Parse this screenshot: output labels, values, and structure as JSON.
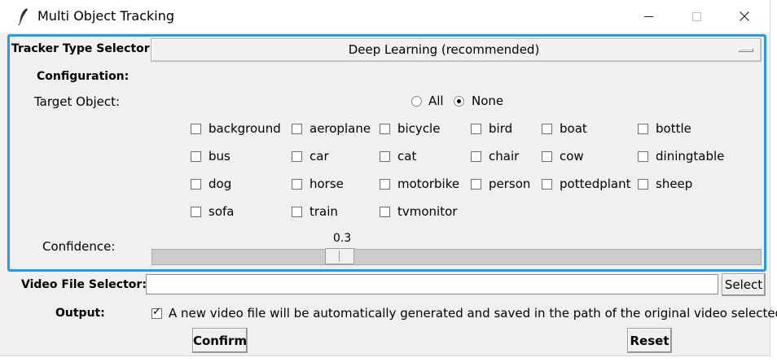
{
  "window": {
    "title": "Multi Object Tracking"
  },
  "tracker": {
    "label": "Tracker Type Selector:",
    "selected": "Deep Learning (recommended)"
  },
  "configuration": {
    "label": "Configuration:"
  },
  "target": {
    "label": "Target Object:",
    "radio_all": "All",
    "radio_none": "None",
    "selected_radio": "None",
    "objects": [
      "background",
      "aeroplane",
      "bicycle",
      "bird",
      "boat",
      "bottle",
      "bus",
      "car",
      "cat",
      "chair",
      "cow",
      "diningtable",
      "dog",
      "horse",
      "motorbike",
      "person",
      "pottedplant",
      "sheep",
      "sofa",
      "train",
      "tvmonitor"
    ]
  },
  "confidence": {
    "label": "Confidence:",
    "value": "0.3"
  },
  "video": {
    "label": "Video File Selector:",
    "path": "",
    "select_label": "Select"
  },
  "output": {
    "label": "Output:",
    "checked": true,
    "text": "A new video file will be automatically generated and saved in the path of the original video selected."
  },
  "actions": {
    "confirm": "Confirm",
    "reset": "Reset"
  }
}
